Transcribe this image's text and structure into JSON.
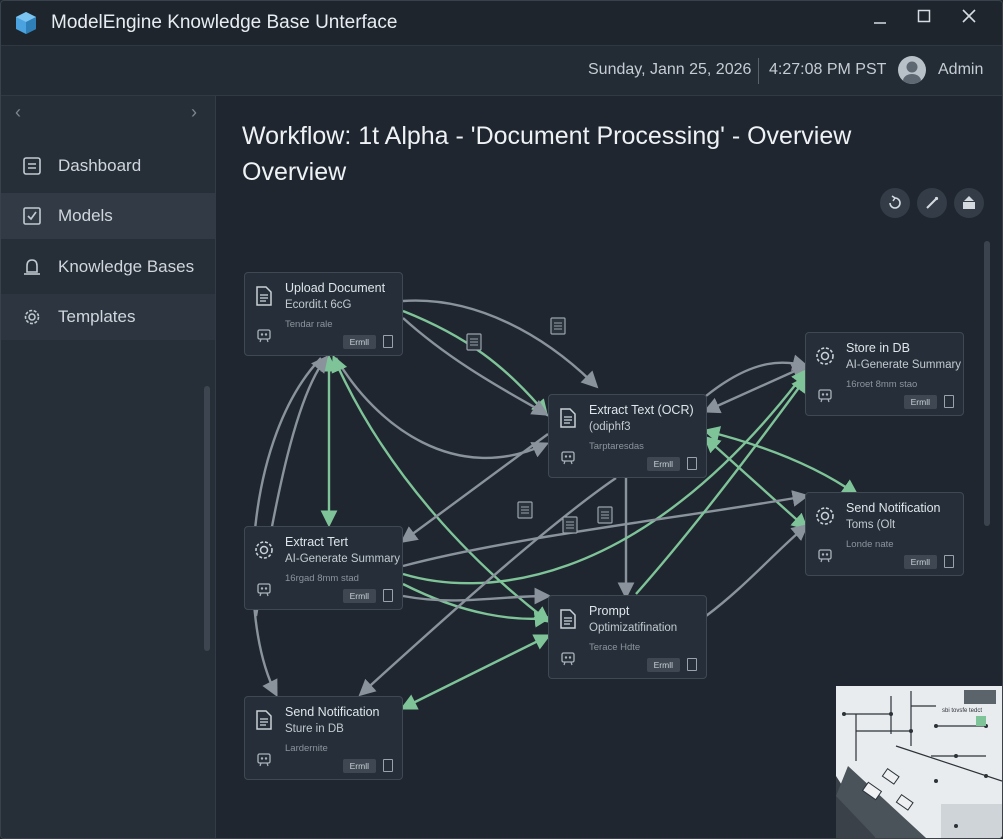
{
  "window": {
    "title": "ModelEngine Knowledge Base Unterface",
    "controls": [
      "minimize",
      "maximize",
      "close"
    ]
  },
  "header": {
    "date": "Sunday, Jann 25, 2026",
    "time": "4:27:08 PM PST",
    "user": "Admin"
  },
  "sidebar": {
    "items": [
      {
        "label": "Dashboard",
        "icon": "dashboard-icon"
      },
      {
        "label": "Models",
        "icon": "checkbox-icon",
        "active": true
      },
      {
        "label": "Knowledge Bases",
        "icon": "bell-icon"
      },
      {
        "label": "Templates",
        "icon": "gear-icon"
      }
    ]
  },
  "main": {
    "title": "Workflow: 1t Alpha - 'Document Processing' - Overview Overview",
    "toolbar": [
      "refresh-icon",
      "edit-icon",
      "export-icon"
    ]
  },
  "nodes": [
    {
      "id": "n1",
      "title": "Upload Document",
      "subtitle": "Ecordit.t 6cG",
      "meta": "Tendar rale",
      "button": "Ermll",
      "icon": "document-icon"
    },
    {
      "id": "n2",
      "title": "Extract Text (OCR)",
      "subtitle": "(odiphf3",
      "meta": "Tarptaresdas",
      "button": "Ermll",
      "icon": "document-icon"
    },
    {
      "id": "n3",
      "title": "Store in DB",
      "subtitle": "AI-Generate Summary",
      "meta": "16roet 8mm stao",
      "button": "Ermll",
      "icon": "gear-icon"
    },
    {
      "id": "n4",
      "title": "Extract Tert",
      "subtitle": "AI-Generate Summary",
      "meta": "16rgad 8mm stad",
      "button": "Ermll",
      "icon": "gear-icon"
    },
    {
      "id": "n5",
      "title": "Send Notification",
      "subtitle": "Toms (Olt",
      "meta": "Londe nate",
      "button": "Ermll",
      "icon": "gear-icon"
    },
    {
      "id": "n6",
      "title": "Prompt",
      "subtitle": "Optimizatifination",
      "meta": "Terace Hdte",
      "button": "Ermll",
      "icon": "document-icon"
    },
    {
      "id": "n7",
      "title": "Send Notification",
      "subtitle": "Sture in DB",
      "meta": "Lardernite",
      "button": "Ermll",
      "icon": "document-icon"
    }
  ],
  "minimap": {
    "label": "sbi tovsfe tedct"
  },
  "colors": {
    "accent_green": "#7fc499",
    "edge_gray": "#8a939c",
    "background": "#1f262f"
  }
}
